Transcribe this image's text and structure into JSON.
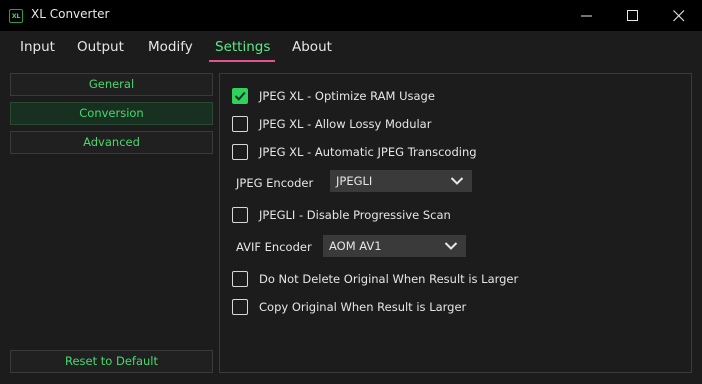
{
  "window": {
    "app_icon_text": "XL",
    "title": "XL Converter"
  },
  "tabs": [
    {
      "label": "Input"
    },
    {
      "label": "Output"
    },
    {
      "label": "Modify"
    },
    {
      "label": "Settings"
    },
    {
      "label": "About"
    }
  ],
  "active_tab": "Settings",
  "colors": {
    "accent_green": "#2fd25f",
    "active_tab_underline": "#e0558e",
    "sidebar_text": "#47d96e"
  },
  "sidebar": {
    "items": [
      {
        "label": "General"
      },
      {
        "label": "Conversion"
      },
      {
        "label": "Advanced"
      }
    ],
    "active_item": "Conversion",
    "reset_label": "Reset to Default"
  },
  "settings": {
    "jxl_optimize_ram": {
      "label": "JPEG XL - Optimize RAM Usage",
      "checked": true
    },
    "jxl_lossy_modular": {
      "label": "JPEG XL - Allow Lossy Modular",
      "checked": false
    },
    "jxl_jpeg_transcoding": {
      "label": "JPEG XL - Automatic JPEG Transcoding",
      "checked": false
    },
    "jpeg_encoder": {
      "label": "JPEG Encoder",
      "value": "JPEGLI"
    },
    "jpegli_progressive": {
      "label": "JPEGLI - Disable Progressive Scan",
      "checked": false
    },
    "avif_encoder": {
      "label": "AVIF Encoder",
      "value": "AOM AV1"
    },
    "keep_original_larger": {
      "label": "Do Not Delete Original When Result is Larger",
      "checked": false
    },
    "copy_original_larger": {
      "label": "Copy Original When Result is Larger",
      "checked": false
    }
  }
}
